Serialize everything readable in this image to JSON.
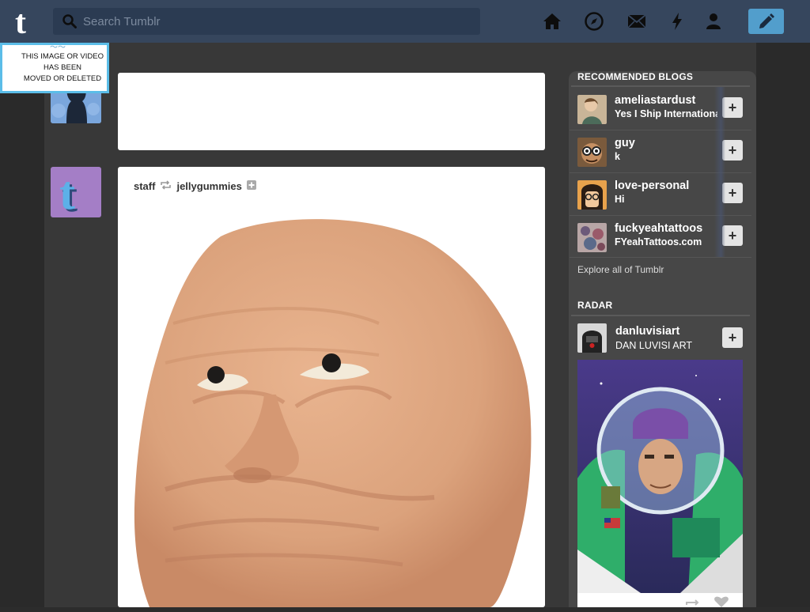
{
  "search": {
    "placeholder": "Search Tumblr"
  },
  "nav": {
    "icons": [
      "home-icon",
      "explore-compass-icon",
      "inbox-mail-icon",
      "activity-lightning-icon",
      "account-person-icon",
      "compose-pencil-icon"
    ]
  },
  "moved_notice": {
    "line1": "THIS IMAGE OR VIDEO",
    "line2": "HAS BEEN",
    "line3": "MOVED OR DELETED"
  },
  "post": {
    "author": "staff",
    "reblogged_from": "jellygummies"
  },
  "recommended": {
    "title": "RECOMMENDED BLOGS",
    "blogs": [
      {
        "name": "ameliastardust",
        "subtitle": "Yes I Ship International"
      },
      {
        "name": "guy",
        "subtitle": "k"
      },
      {
        "name": "love-personal",
        "subtitle": "Hi"
      },
      {
        "name": "fuckyeahtattoos",
        "subtitle": "FYeahTattoos.com"
      }
    ],
    "follow_label": "+",
    "explore_link": "Explore all of Tumblr"
  },
  "radar": {
    "title": "RADAR",
    "blog_name": "danluvisiart",
    "blog_subtitle": "DAN LUVISI ART",
    "follow_label": "+"
  },
  "colors": {
    "header": "#36465d",
    "compose": "#529ecc",
    "dashboard": "#383838",
    "sidebar": "#474747"
  }
}
